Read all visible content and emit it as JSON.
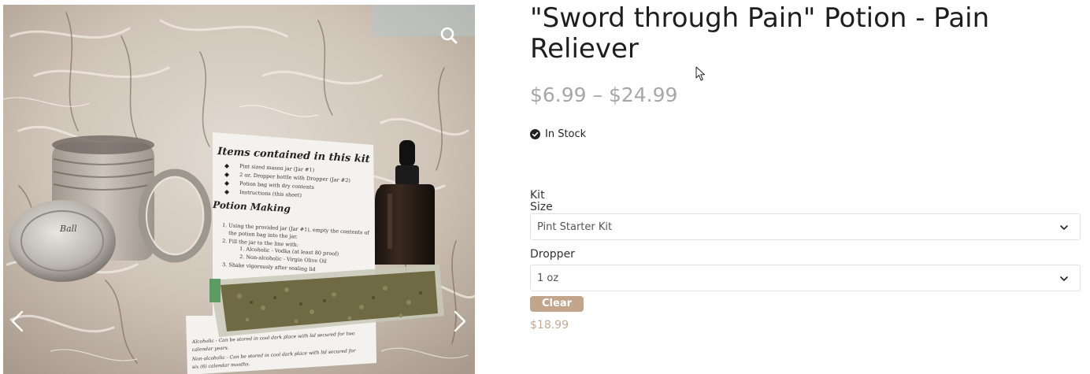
{
  "product": {
    "title": "\"Sword through Pain\" Potion - Pain Reliever",
    "price_range": "$6.99 – $24.99",
    "stock_status": "In Stock",
    "variation_price": "$18.99"
  },
  "gallery": {
    "zoom_icon": "magnifier-icon",
    "prev_icon": "chevron-left-icon",
    "next_icon": "chevron-right-icon",
    "sheet": {
      "heading": "Items contained in this kit",
      "items": [
        "Pint sized mason jar (Jar #1)",
        "2 oz. Dropper bottle with Dropper (Jar #2)",
        "Potion bag with dry contents",
        "Instructions (this sheet)"
      ],
      "section": "Potion Making",
      "steps": [
        "1. Using the provided jar (Jar #1), empty the contents of",
        "the potion bag into the jar.",
        "2. Fill the jar to the line with:",
        "1. Alcoholic - Vodka (at least 80 proof)",
        "2. Non-alcoholic - Virgin Olive Oil",
        "3. Shake vigorously after sealing lid"
      ],
      "footer": [
        "Alcoholic - Can be stored in cool dark place with lid secured for two",
        "calendar years.",
        "Non-alcoholic - Can be stored in cool dark place with lid secured for",
        "six (6) calendar months."
      ],
      "lid_text": "Ball"
    }
  },
  "variations": {
    "kit_size": {
      "label_line1": "Kit",
      "label_line2": "Size",
      "selected": "Pint Starter Kit"
    },
    "dropper": {
      "label": "Dropper",
      "selected": "1 oz"
    },
    "clear_label": "Clear"
  },
  "colors": {
    "price_range": "#a7a7a7",
    "clear_button": "#c2a68b",
    "variation_price": "#c3ab93",
    "title": "#1e1e1e"
  }
}
